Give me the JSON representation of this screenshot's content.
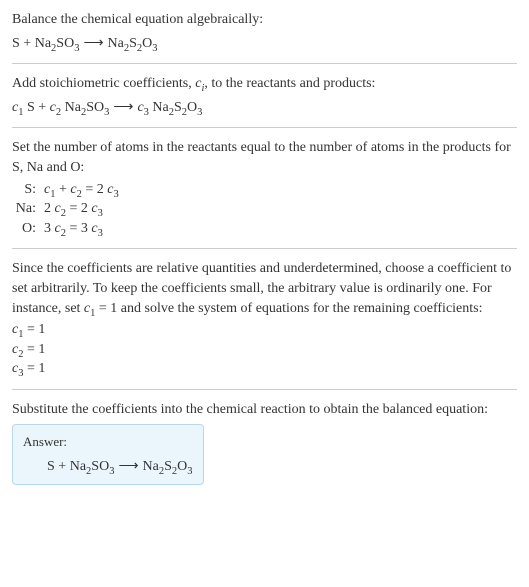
{
  "intro": {
    "line1": "Balance the chemical equation algebraically:"
  },
  "eq1": {
    "s": "S",
    "plus": " + ",
    "na2so3_na": "Na",
    "na2so3_2a": "2",
    "na2so3_s": "SO",
    "na2so3_3": "3",
    "arrow": "⟶",
    "na2s2o3_na": "Na",
    "na2s2o3_2a": "2",
    "na2s2o3_s": "S",
    "na2s2o3_2b": "2",
    "na2s2o3_o": "O",
    "na2s2o3_3": "3"
  },
  "step2": {
    "text": "Add stoichiometric coefficients, ",
    "ci_c": "c",
    "ci_i": "i",
    "text2": ", to the reactants and products:"
  },
  "eq2": {
    "c1_c": "c",
    "c1_1": "1",
    "sp": " ",
    "s": "S",
    "plus": " + ",
    "c2_c": "c",
    "c2_2": "2",
    "na2so3_na": "Na",
    "na2so3_2a": "2",
    "na2so3_s": "SO",
    "na2so3_3": "3",
    "arrow": "⟶",
    "c3_c": "c",
    "c3_3": "3",
    "na2s2o3_na": "Na",
    "na2s2o3_2a": "2",
    "na2s2o3_s": "S",
    "na2s2o3_2b": "2",
    "na2s2o3_o": "O",
    "na2s2o3_3b": "3"
  },
  "step3": {
    "text": "Set the number of atoms in the reactants equal to the number of atoms in the products for S, Na and O:"
  },
  "atoms": {
    "s_label": "S:",
    "s_lhs_c1c": "c",
    "s_lhs_c1n": "1",
    "s_plus": " + ",
    "s_lhs_c2c": "c",
    "s_lhs_c2n": "2",
    "s_eq": " = 2 ",
    "s_rhs_c3c": "c",
    "s_rhs_c3n": "3",
    "na_label": "Na:",
    "na_lhs_2": "2 ",
    "na_lhs_c2c": "c",
    "na_lhs_c2n": "2",
    "na_eq": " = 2 ",
    "na_rhs_c3c": "c",
    "na_rhs_c3n": "3",
    "o_label": "O:",
    "o_lhs_3": "3 ",
    "o_lhs_c2c": "c",
    "o_lhs_c2n": "2",
    "o_eq": " = 3 ",
    "o_rhs_c3c": "c",
    "o_rhs_c3n": "3"
  },
  "step4": {
    "text1": "Since the coefficients are relative quantities and underdetermined, choose a coefficient to set arbitrarily. To keep the coefficients small, the arbitrary value is ordinarily one. For instance, set ",
    "c1c": "c",
    "c1n": "1",
    "text2": " = 1 and solve the system of equations for the remaining coefficients:"
  },
  "solved": {
    "c1c": "c",
    "c1n": "1",
    "c1v": " = 1",
    "c2c": "c",
    "c2n": "2",
    "c2v": " = 1",
    "c3c": "c",
    "c3n": "3",
    "c3v": " = 1"
  },
  "step5": {
    "text": "Substitute the coefficients into the chemical reaction to obtain the balanced equation:"
  },
  "answer": {
    "label": "Answer:",
    "s": "S",
    "plus": " + ",
    "na2so3_na": "Na",
    "na2so3_2a": "2",
    "na2so3_s": "SO",
    "na2so3_3": "3",
    "arrow": "⟶",
    "na2s2o3_na": "Na",
    "na2s2o3_2a": "2",
    "na2s2o3_s": "S",
    "na2s2o3_2b": "2",
    "na2s2o3_o": "O",
    "na2s2o3_3": "3"
  }
}
